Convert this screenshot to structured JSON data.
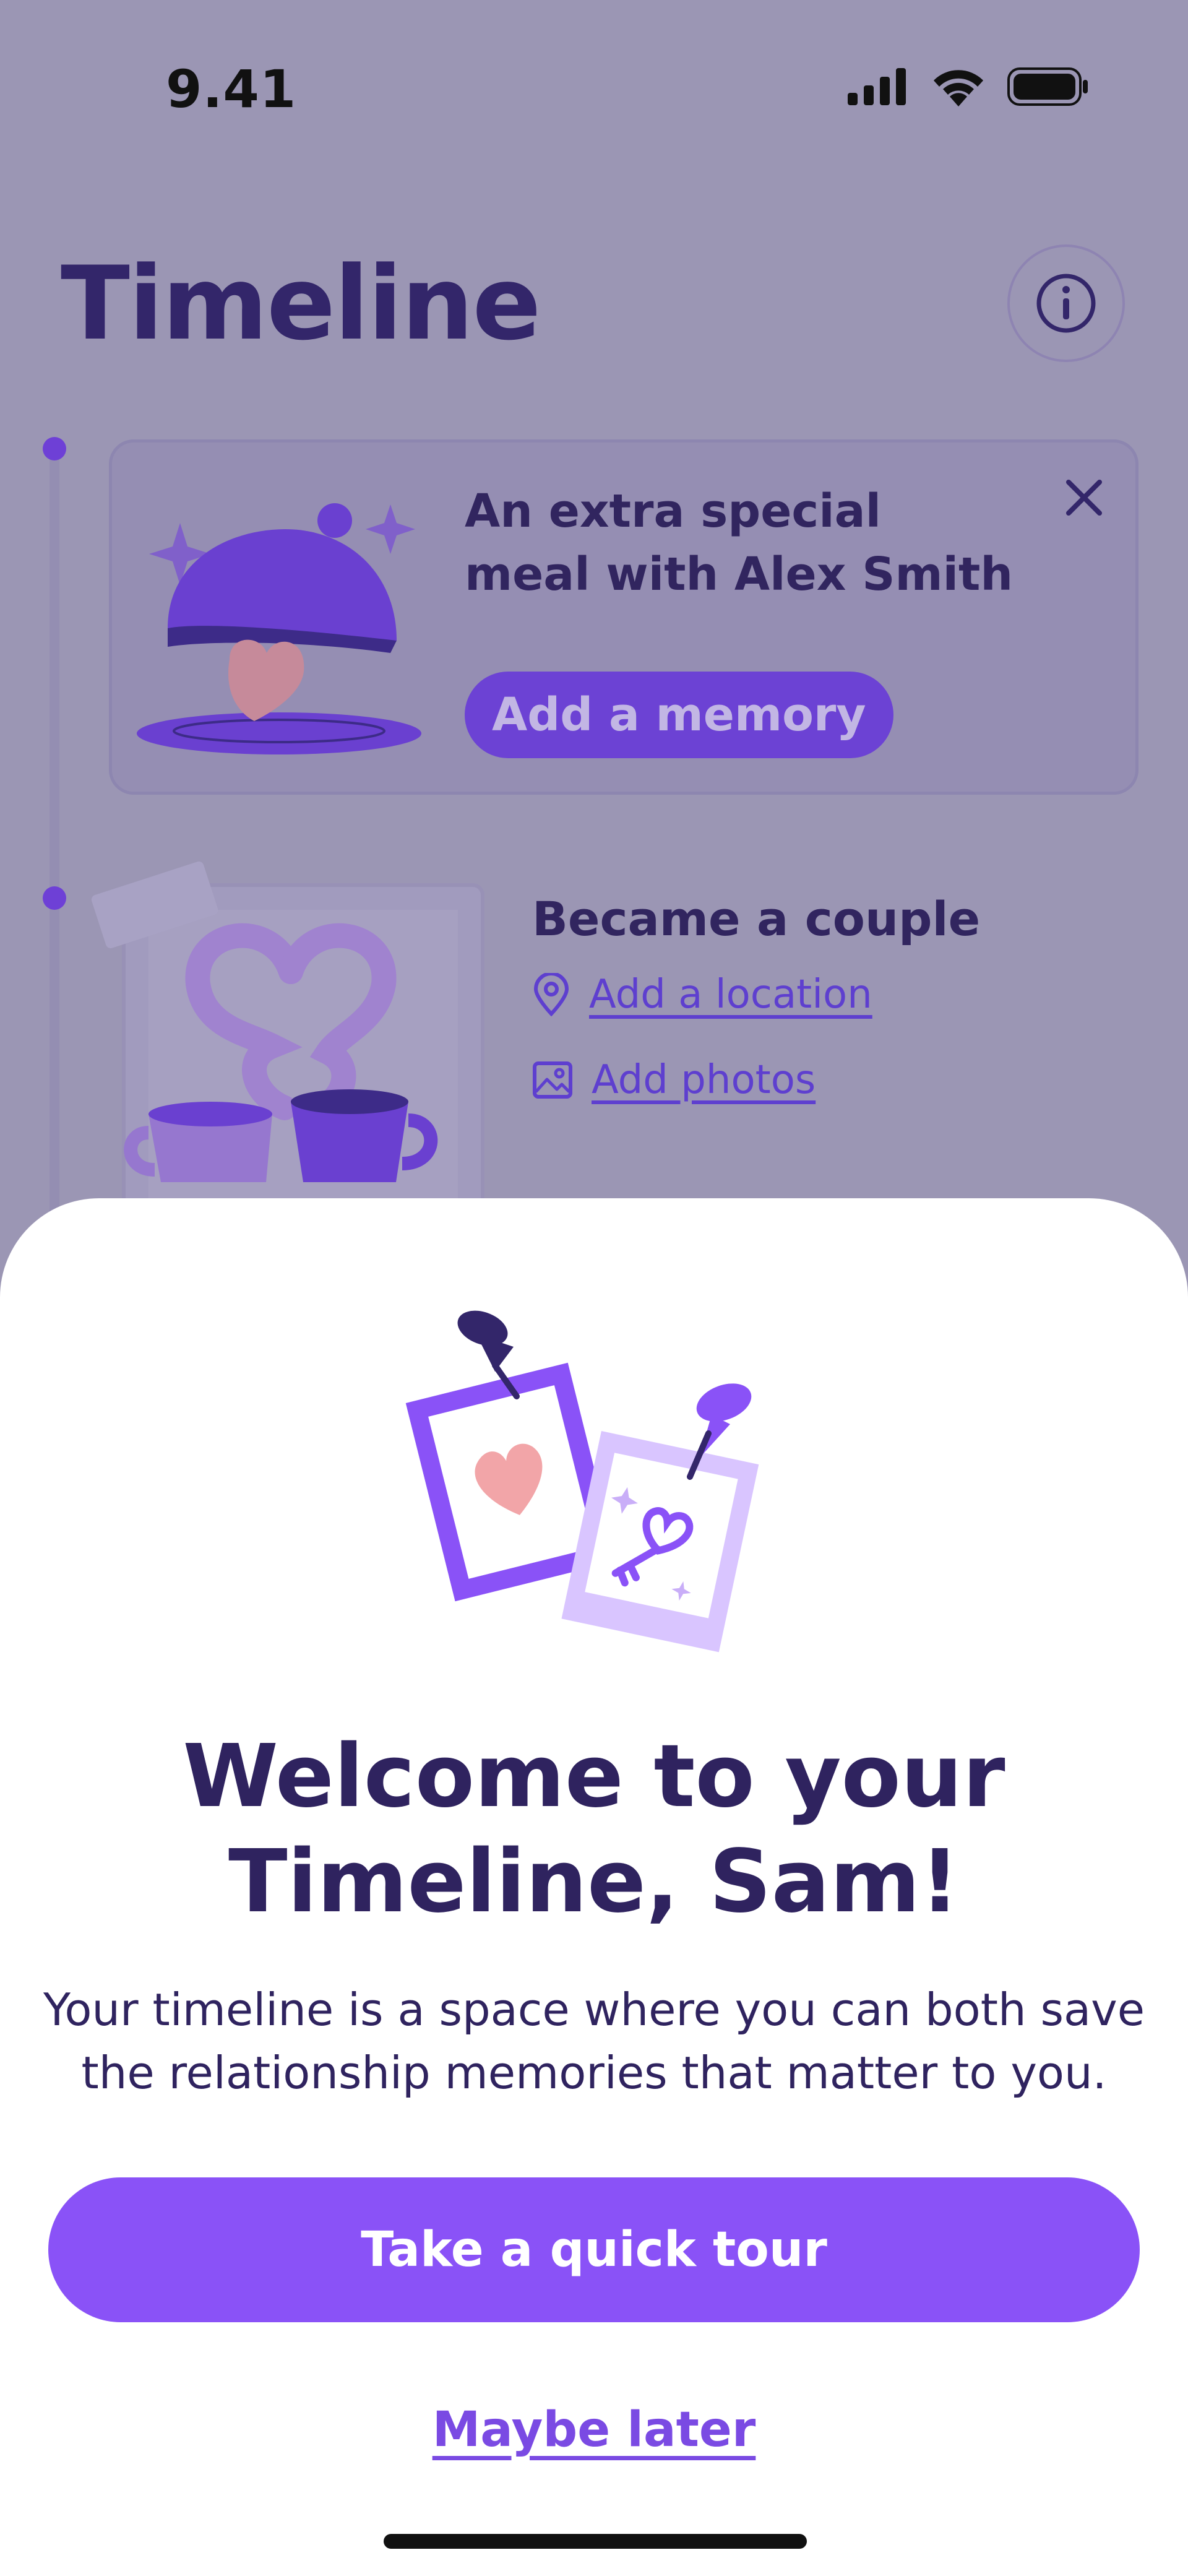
{
  "status_bar": {
    "time": "9.41",
    "icons": [
      "signal-icon",
      "wifi-icon",
      "battery-icon"
    ]
  },
  "header": {
    "title": "Timeline",
    "info_icon": "info-icon"
  },
  "timeline": {
    "items": [
      {
        "title": "An extra special meal with Alex Smith",
        "action_label": "Add a memory",
        "close_icon": "close-icon",
        "illustration": "cloche-heart-illustration"
      },
      {
        "title": "Became a couple",
        "location_label": "Add a location",
        "photos_label": "Add photos",
        "illustration": "coffee-cups-heart-illustration"
      }
    ]
  },
  "welcome_sheet": {
    "illustration": "pinned-photos-illustration",
    "title_line1": "Welcome to your",
    "title_line2": "Timeline, Sam!",
    "body_line1": "Your timeline is a space where you can both save",
    "body_line2": "the relationship memories that matter to you.",
    "primary_button": "Take a quick tour",
    "secondary_link": "Maybe later"
  },
  "colors": {
    "overlay_background": "#9b96b4",
    "title_text": "#2f235f",
    "accent_purple": "#8a52f7",
    "card_button": "#6c42d4",
    "link_purple": "#7a4ae3"
  }
}
